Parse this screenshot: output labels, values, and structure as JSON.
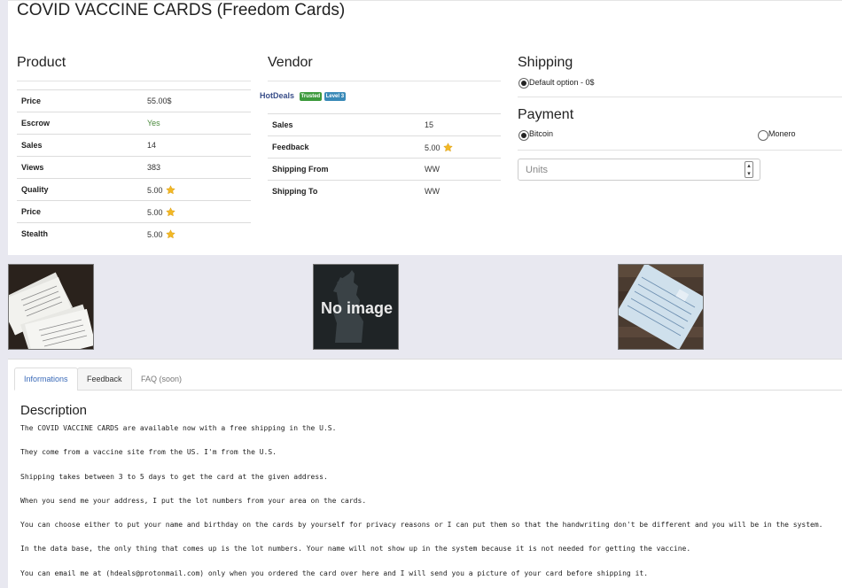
{
  "title": "COVID VACCINE CARDS (Freedom Cards)",
  "product": {
    "heading": "Product",
    "rows": [
      {
        "label": "Price",
        "value": "55.00$"
      },
      {
        "label": "Escrow",
        "value": "Yes"
      },
      {
        "label": "Sales",
        "value": "14"
      },
      {
        "label": "Views",
        "value": "383"
      },
      {
        "label": "Quality",
        "value": "5.00"
      },
      {
        "label": "Price",
        "value": "5.00"
      },
      {
        "label": "Stealth",
        "value": "5.00"
      }
    ]
  },
  "vendor": {
    "heading": "Vendor",
    "name": "HotDeals",
    "badge_trusted": "Trusted",
    "badge_level": "Level 3",
    "rows": [
      {
        "label": "Sales",
        "value": "15"
      },
      {
        "label": "Feedback",
        "value": "5.00"
      },
      {
        "label": "Shipping From",
        "value": "WW"
      },
      {
        "label": "Shipping To",
        "value": "WW"
      }
    ]
  },
  "shipping": {
    "heading": "Shipping",
    "option": "Default option - 0$"
  },
  "payment": {
    "heading": "Payment",
    "options": [
      "Bitcoin",
      "Monero"
    ],
    "selected": "Bitcoin"
  },
  "units": {
    "placeholder": "Units"
  },
  "images": {
    "placeholder_text": "No image"
  },
  "tabs": {
    "informations": "Informations",
    "feedback": "Feedback",
    "faq": "FAQ (soon)"
  },
  "description": {
    "heading": "Description",
    "paragraphs": [
      "The COVID VACCINE CARDS are available now with a free shipping in the U.S.",
      "They come from a vaccine site from the US. I'm from the U.S.",
      "Shipping takes between 3 to 5 days to get the card at the given address.",
      "When you send me your address, I put the lot numbers from your area on the cards.",
      "You can choose either to put your name and birthday on the cards by yourself for privacy reasons or I can put them so that the handwriting don't be different and you will be in the system.",
      "In the data base, the only thing that comes up is the lot numbers. Your name will not show up in the system because it is not needed for getting the vaccine.",
      "You can email me at (hdeals@protonmail.com) only when you ordered the card over here and I will send you a picture of your card before shipping it."
    ]
  },
  "colors": {
    "star": "#f2b825",
    "trusted_badge": "#3d9a3d",
    "level_badge": "#3a8ab8",
    "escrow_yes": "#4a8a3c"
  }
}
